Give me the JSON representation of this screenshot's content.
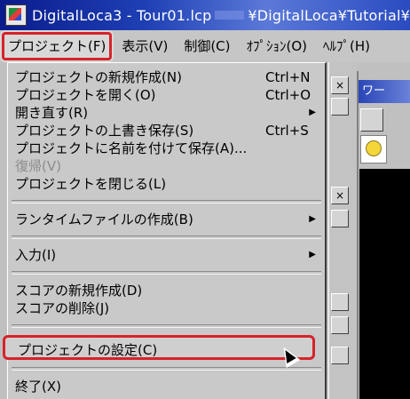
{
  "window": {
    "title_left": "DigitalLoca3 - Tour01.lcp",
    "title_right": "¥DigitalLoca¥Tutorial¥"
  },
  "menubar": [
    {
      "label": "プロジェクト(F)"
    },
    {
      "label": "表示(V)"
    },
    {
      "label": "制御(C)"
    },
    {
      "label": "ｵﾌﾟｼｮﾝ(O)"
    },
    {
      "label": "ﾍﾙﾌﾟ(H)"
    }
  ],
  "dropdown": {
    "group1": [
      {
        "label": "プロジェクトの新規作成(N)",
        "shortcut": "Ctrl+N"
      },
      {
        "label": "プロジェクトを開く(O)",
        "shortcut": "Ctrl+O"
      },
      {
        "label": "開き直す(R)",
        "shortcut": ""
      },
      {
        "label": "プロジェクトの上書き保存(S)",
        "shortcut": "Ctrl+S"
      },
      {
        "label": "プロジェクトに名前を付けて保存(A)...",
        "shortcut": ""
      },
      {
        "label": "復帰(V)",
        "shortcut": ""
      },
      {
        "label": "プロジェクトを閉じる(L)",
        "shortcut": ""
      }
    ],
    "runtime": {
      "label": "ランタイムファイルの作成(B)"
    },
    "input": {
      "label": "入力(I)"
    },
    "group4": [
      {
        "label": "スコアの新規作成(D)"
      },
      {
        "label": "スコアの削除(J)"
      }
    ],
    "settings": {
      "label": "プロジェクトの設定(C)"
    },
    "exit": {
      "label": "終了(X)"
    },
    "arrow_glyph": "▶"
  },
  "background": {
    "inner_title": "ワー",
    "btn_glyph": "×"
  },
  "colors": {
    "highlight_border": "#d6232a",
    "title_bar": "#1e3fb4"
  }
}
